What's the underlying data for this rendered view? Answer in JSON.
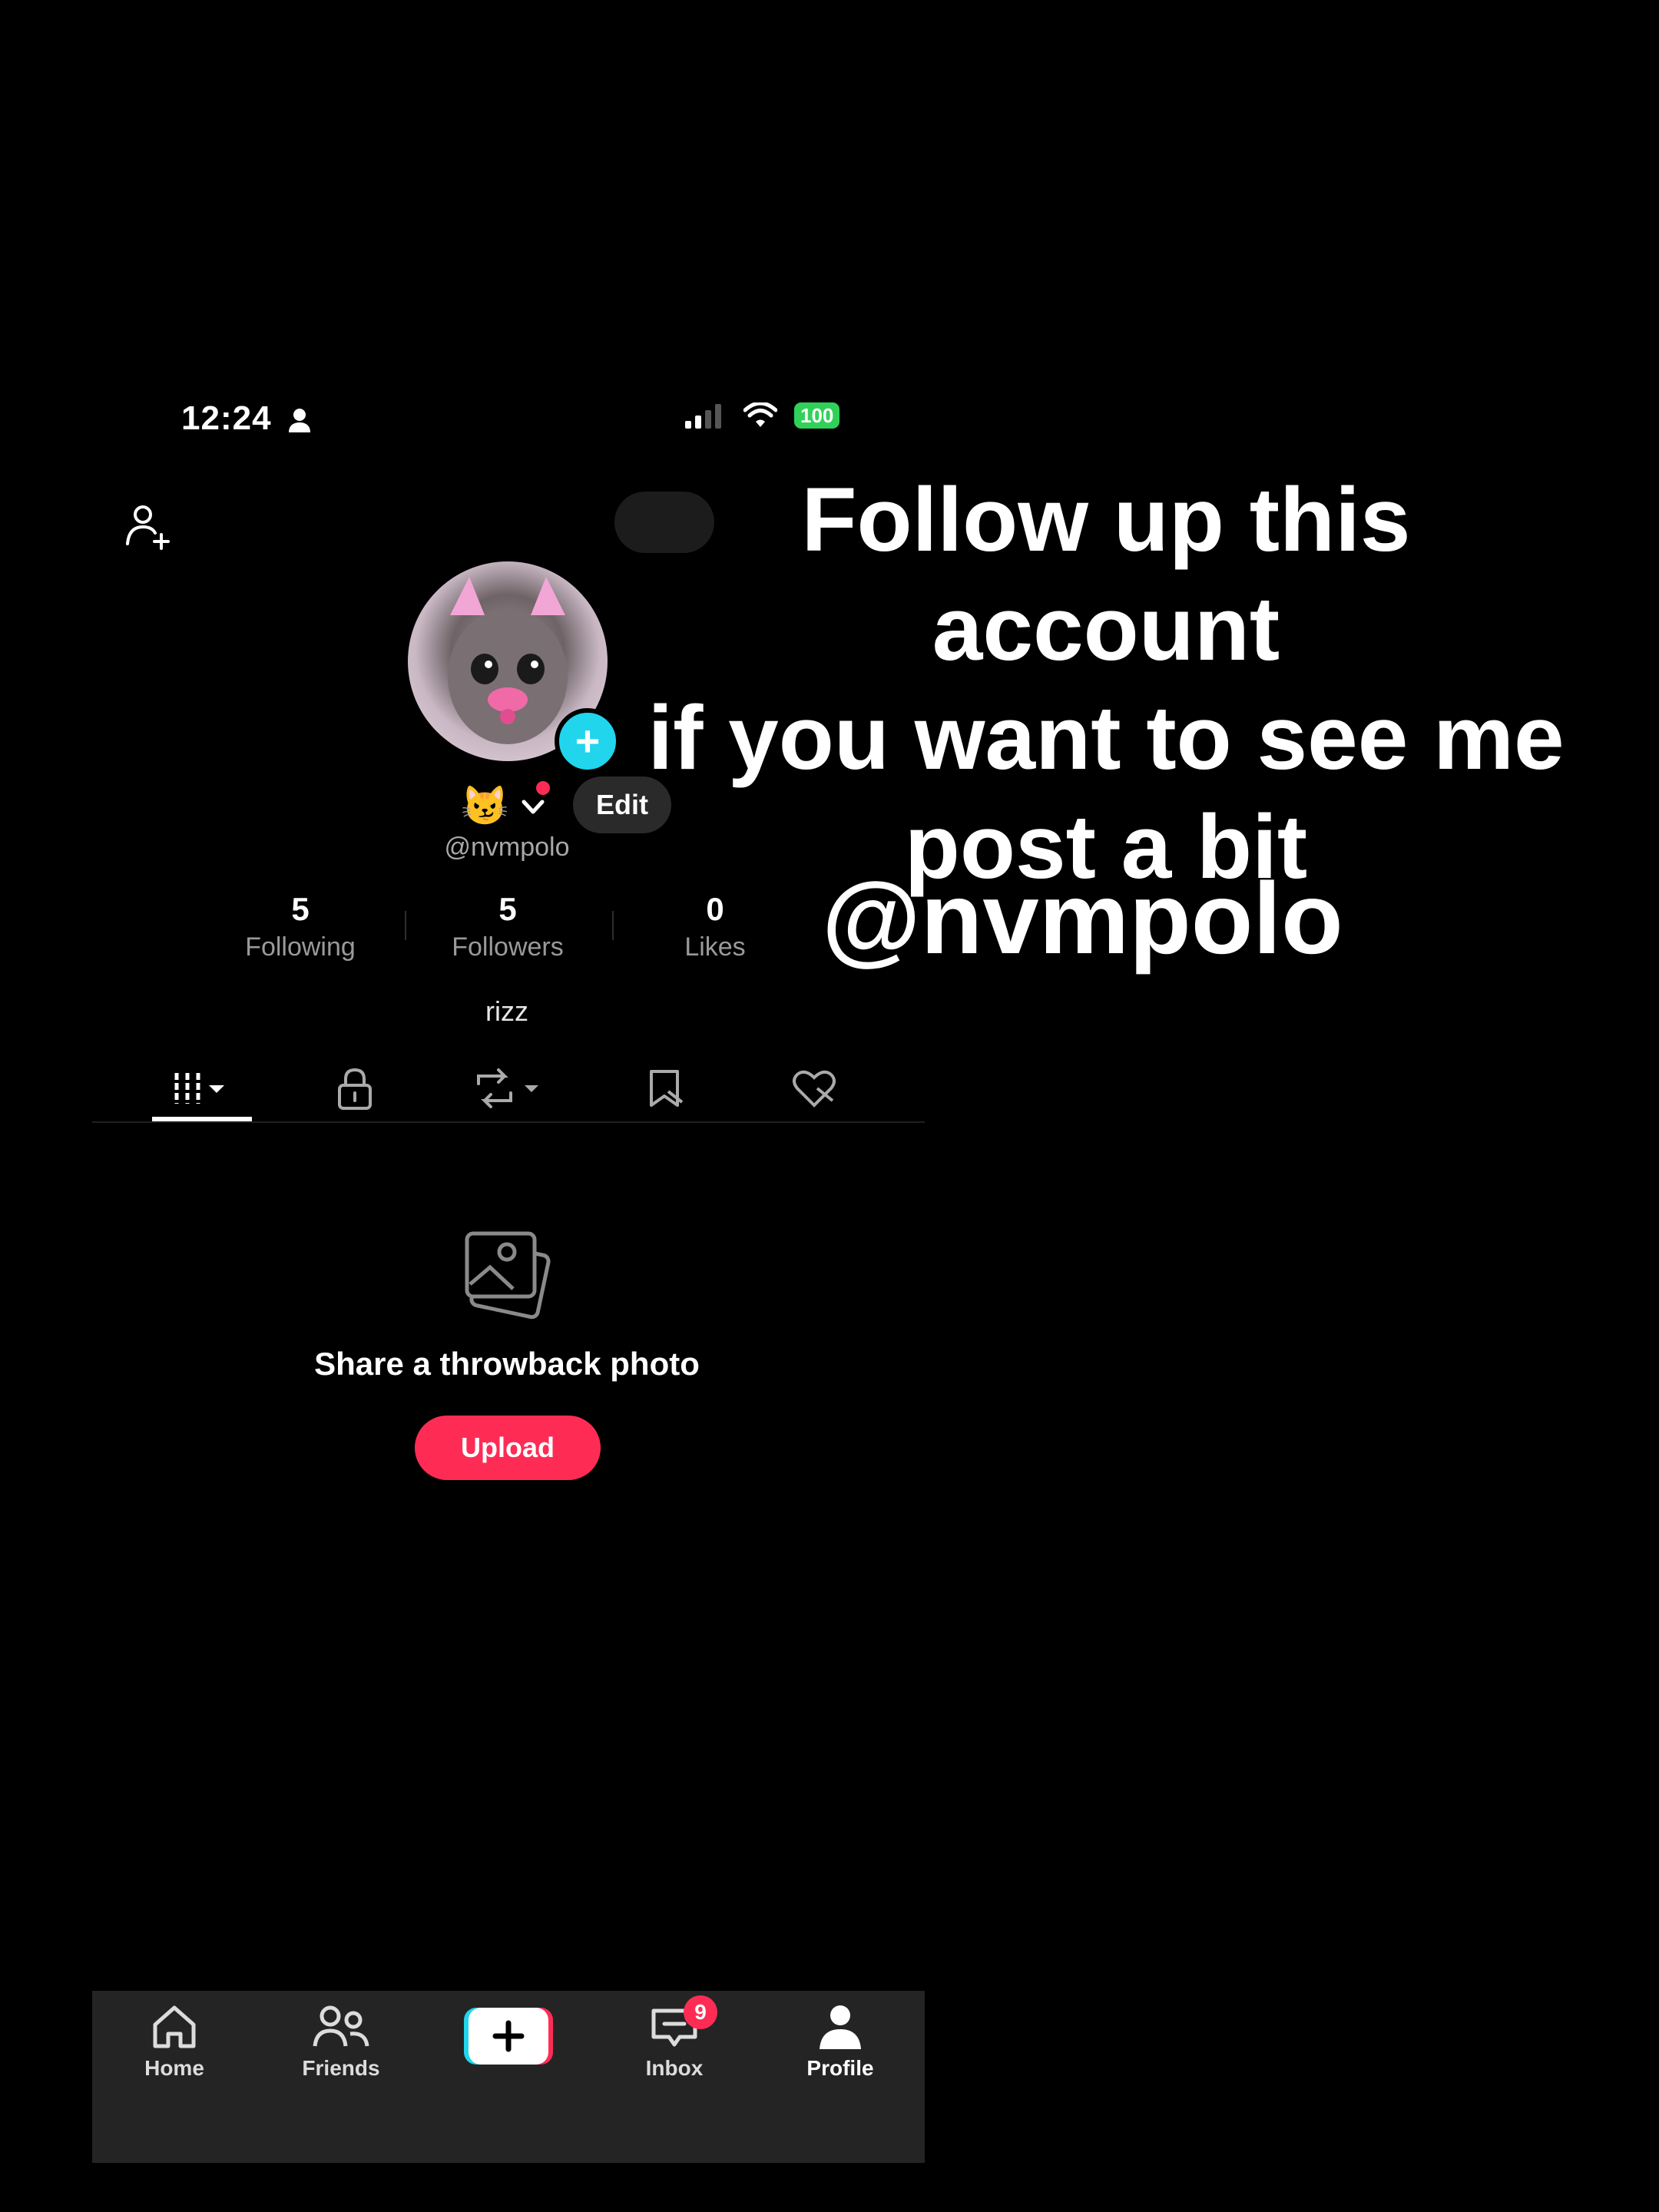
{
  "status_bar": {
    "time": "12:24",
    "battery": "100"
  },
  "profile": {
    "handle": "@nvmpolo",
    "edit_label": "Edit",
    "emoji": "😼",
    "bio": "rizz",
    "stats": [
      {
        "value": "5",
        "label": "Following"
      },
      {
        "value": "5",
        "label": "Followers"
      },
      {
        "value": "0",
        "label": "Likes"
      }
    ]
  },
  "tabs": [
    "videos-icon",
    "lock-icon",
    "repost-icon",
    "favorites-icon",
    "liked-icon"
  ],
  "empty_state": {
    "title": "Share a throwback photo",
    "button": "Upload"
  },
  "bottom_nav": {
    "items": [
      {
        "label": "Home"
      },
      {
        "label": "Friends"
      },
      {
        "label": ""
      },
      {
        "label": "Inbox",
        "badge": "9"
      },
      {
        "label": "Profile"
      }
    ]
  },
  "overlay": {
    "lines": [
      "Follow up this account",
      "if you want to see me",
      "post a bit"
    ],
    "handle": "@nvmpolo"
  },
  "colors": {
    "accent": "#fe2c55",
    "cyan": "#20d5ec",
    "battery": "#30d158",
    "navbar": "#242424"
  }
}
